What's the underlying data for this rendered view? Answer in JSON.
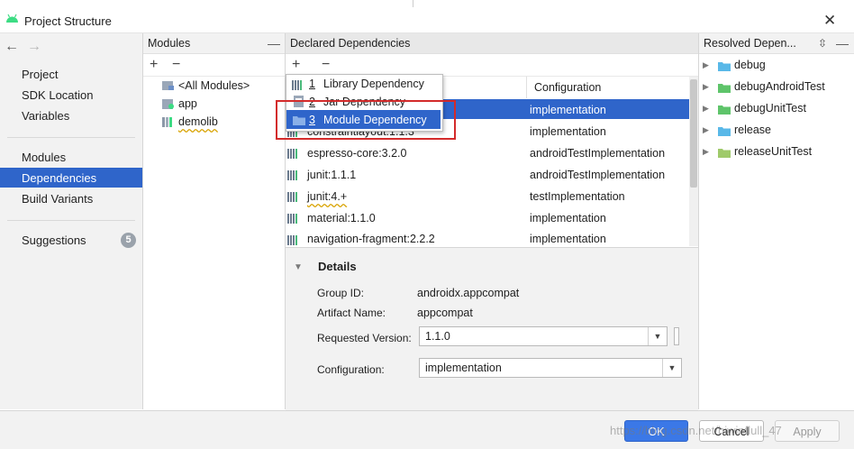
{
  "window": {
    "title": "Project Structure"
  },
  "nav": {
    "items": [
      "Project",
      "SDK Location",
      "Variables",
      "Modules",
      "Dependencies",
      "Build Variants",
      "Suggestions"
    ],
    "suggestions_count": "5"
  },
  "modules": {
    "header": "Modules",
    "items": [
      "<All Modules>",
      "app",
      "demolib"
    ]
  },
  "deps": {
    "header": "Declared Dependencies",
    "col_config": "Configuration",
    "rows": [
      {
        "name": "",
        "config": "implementation"
      },
      {
        "name": "constraintlayout:1.1.3",
        "config": "implementation"
      },
      {
        "name": "espresso-core:3.2.0",
        "config": "androidTestImplementation"
      },
      {
        "name": "junit:1.1.1",
        "config": "androidTestImplementation"
      },
      {
        "name": "junit:4.+",
        "config": "testImplementation"
      },
      {
        "name": "material:1.1.0",
        "config": "implementation"
      },
      {
        "name": "navigation-fragment:2.2.2",
        "config": "implementation"
      }
    ]
  },
  "popup": {
    "items": [
      {
        "num": "1",
        "label": "Library Dependency"
      },
      {
        "num": "2",
        "label": "Jar Dependency"
      },
      {
        "num": "3",
        "label": "Module Dependency"
      }
    ]
  },
  "details": {
    "title": "Details",
    "group_id_label": "Group ID:",
    "group_id": "androidx.appcompat",
    "artifact_label": "Artifact Name:",
    "artifact": "appcompat",
    "version_label": "Requested Version:",
    "version": "1.1.0",
    "config_label": "Configuration:",
    "config": "implementation"
  },
  "resolved": {
    "header": "Resolved Depen...",
    "items": [
      "debug",
      "debugAndroidTest",
      "debugUnitTest",
      "release",
      "releaseUnitTest"
    ]
  },
  "buttons": {
    "ok": "OK",
    "cancel": "Cancel",
    "apply": "Apply"
  },
  "watermark": "https://blog.csdn.net/hiwinflull_47"
}
